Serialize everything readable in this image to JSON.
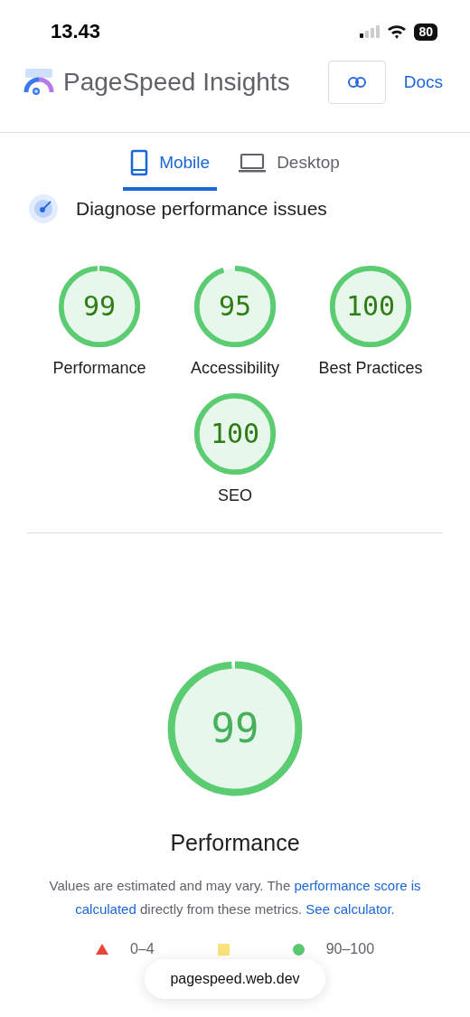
{
  "status_bar": {
    "time": "13.43",
    "battery": "80"
  },
  "header": {
    "title": "PageSpeed Insights",
    "docs": "Docs"
  },
  "tabs": [
    {
      "label": "Mobile",
      "kind": "phone",
      "selected": true
    },
    {
      "label": "Desktop",
      "kind": "laptop",
      "selected": false
    }
  ],
  "section_title": "Diagnose performance issues",
  "scores": [
    {
      "score": "99",
      "label": "Performance",
      "level": 0.99
    },
    {
      "score": "95",
      "label": "Accessibility",
      "level": 0.95
    },
    {
      "score": "100",
      "label": "Best Practices",
      "level": 1
    },
    {
      "score": "100",
      "label": "SEO",
      "level": 1
    }
  ],
  "main_score": {
    "score": "99",
    "label": "Performance",
    "level": 0.99
  },
  "description": [
    {
      "kind": "text",
      "text": "Values are estimated and may vary. The "
    },
    {
      "kind": "link",
      "text": "performance score is"
    },
    {
      "kind": "link",
      "text": "calculated"
    },
    {
      "kind": "text",
      "text": " directly from these metrics. "
    },
    {
      "kind": "link",
      "text": "See calculator."
    }
  ],
  "legend": [
    {
      "kind": "triangle",
      "color": "#e8453c",
      "range": "0–4"
    },
    {
      "kind": "square",
      "color": "#fbe27b"
    },
    {
      "kind": "circle",
      "color": "#5ac86f",
      "range": "90–100"
    }
  ],
  "url_bar": {
    "url": "pagespeed.web.dev"
  }
}
